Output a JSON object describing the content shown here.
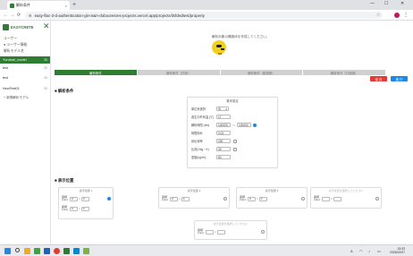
{
  "browser": {
    "tab_title": "解析条件",
    "tab_close": "×",
    "new_tab": "+",
    "url": "easy-flac-3-d-authentication-git-main-dobooresres-projects.vercel.app/projects/ilsfdedtest/property",
    "controls": {
      "minimize": "—",
      "maximize": "☐",
      "close": "✕"
    }
  },
  "sidebar": {
    "logo_text": "EASYCRETE",
    "close_icon": "✕",
    "line1": "ユーザー",
    "line2": "● ユーザー情報",
    "line3": "解析モデル名",
    "items": [
      {
        "label": "Yuruhuri_model",
        "sfx": "3D",
        "active": true
      },
      {
        "label": "test",
        "sfx": "3D",
        "active": false
      },
      {
        "label": "test",
        "sfx": "3D",
        "active": false
      },
      {
        "label": "NewTest01",
        "sfx": "3D",
        "active": false
      }
    ],
    "sub_item": "+ 新規解析モデル"
  },
  "main": {
    "top_note": "解析対象の構造体を作成してください。",
    "steps": [
      "解析条件",
      "解析条件（打設）",
      "解析条件（構造物）",
      "解析条件（打設順）"
    ],
    "btn_red": "保 存",
    "btn_blue": "実 行",
    "section1": "■ 解析条件",
    "section2": "■ 表示位置"
  },
  "form": {
    "card_title": "基本設定",
    "rows": [
      {
        "label": "単位系選択",
        "type": "select",
        "value": "SI"
      },
      {
        "label": "養生中外気温 (℃)",
        "type": "input",
        "value": "17"
      },
      {
        "label": "解析時間 (hrs)",
        "type": "range",
        "value": "100000",
        "value2": "100000",
        "sep": "〜"
      },
      {
        "label": "時間刻み",
        "type": "input",
        "value": "0.01"
      },
      {
        "label": "熱伝導率",
        "type": "check",
        "value": "200"
      },
      {
        "label": "比熱(J/kg・K)",
        "type": "check",
        "value": "30"
      },
      {
        "label": "密度(kg/m³)",
        "type": "input",
        "value": "60"
      }
    ]
  },
  "positions": {
    "cards": [
      {
        "title": "表示位置 1",
        "dim": false,
        "x_label": "座標 (mm)",
        "x1": "0",
        "x2": "0",
        "y_label": "座標 (mm)",
        "y1": "0",
        "y2": "0",
        "radio_on": true,
        "two_rows": true
      },
      {
        "title": "表示位置 2",
        "dim": false,
        "x_label": "座標 (mm)",
        "x1": "0",
        "x2": "0",
        "radio_on": false,
        "two_rows": false
      },
      {
        "title": "表示位置 3",
        "dim": false,
        "x_label": "座標 (mm)",
        "x1": "0",
        "x2": "0",
        "radio_on": false,
        "two_rows": false
      },
      {
        "title": "表示位置を選択してください",
        "dim": true,
        "x_label": "座標 (mm)",
        "x1": "",
        "x2": "",
        "radio_on": false,
        "two_rows": false
      }
    ],
    "bottom_card": {
      "title": "表示位置を選択してください",
      "x_label": "座標 (mm)",
      "x1": "",
      "x2": "",
      "radio_on": false
    },
    "sep": "×"
  },
  "taskbar": {
    "time": "15:33",
    "date": "2025/02/07",
    "tray_text": "A"
  }
}
